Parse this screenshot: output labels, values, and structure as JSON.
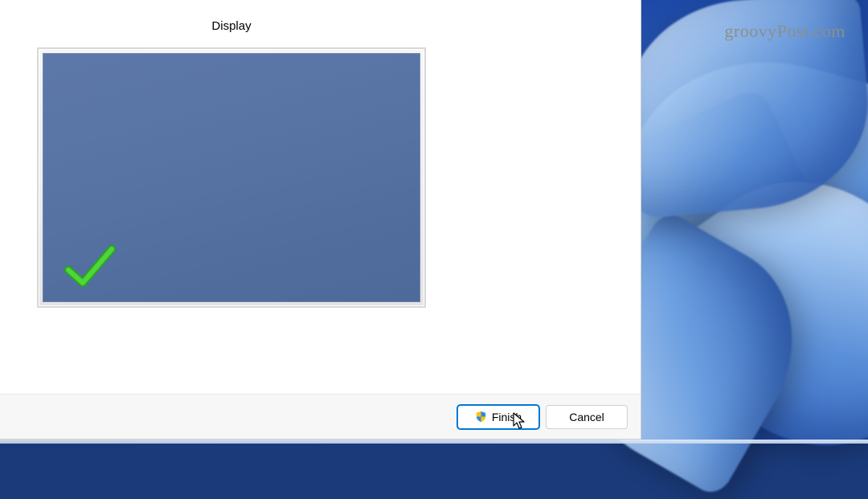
{
  "dialog": {
    "section_title": "Display",
    "buttons": {
      "finish": "Finish",
      "cancel": "Cancel"
    }
  },
  "watermark": "groovyPost.com",
  "icons": {
    "shield": "uac-shield-icon",
    "checkmark": "success-check-icon",
    "cursor": "pointer-cursor-icon"
  },
  "colors": {
    "accent": "#0078d4",
    "monitor_screen": "#5572a2",
    "check_green": "#3fbf2f"
  }
}
